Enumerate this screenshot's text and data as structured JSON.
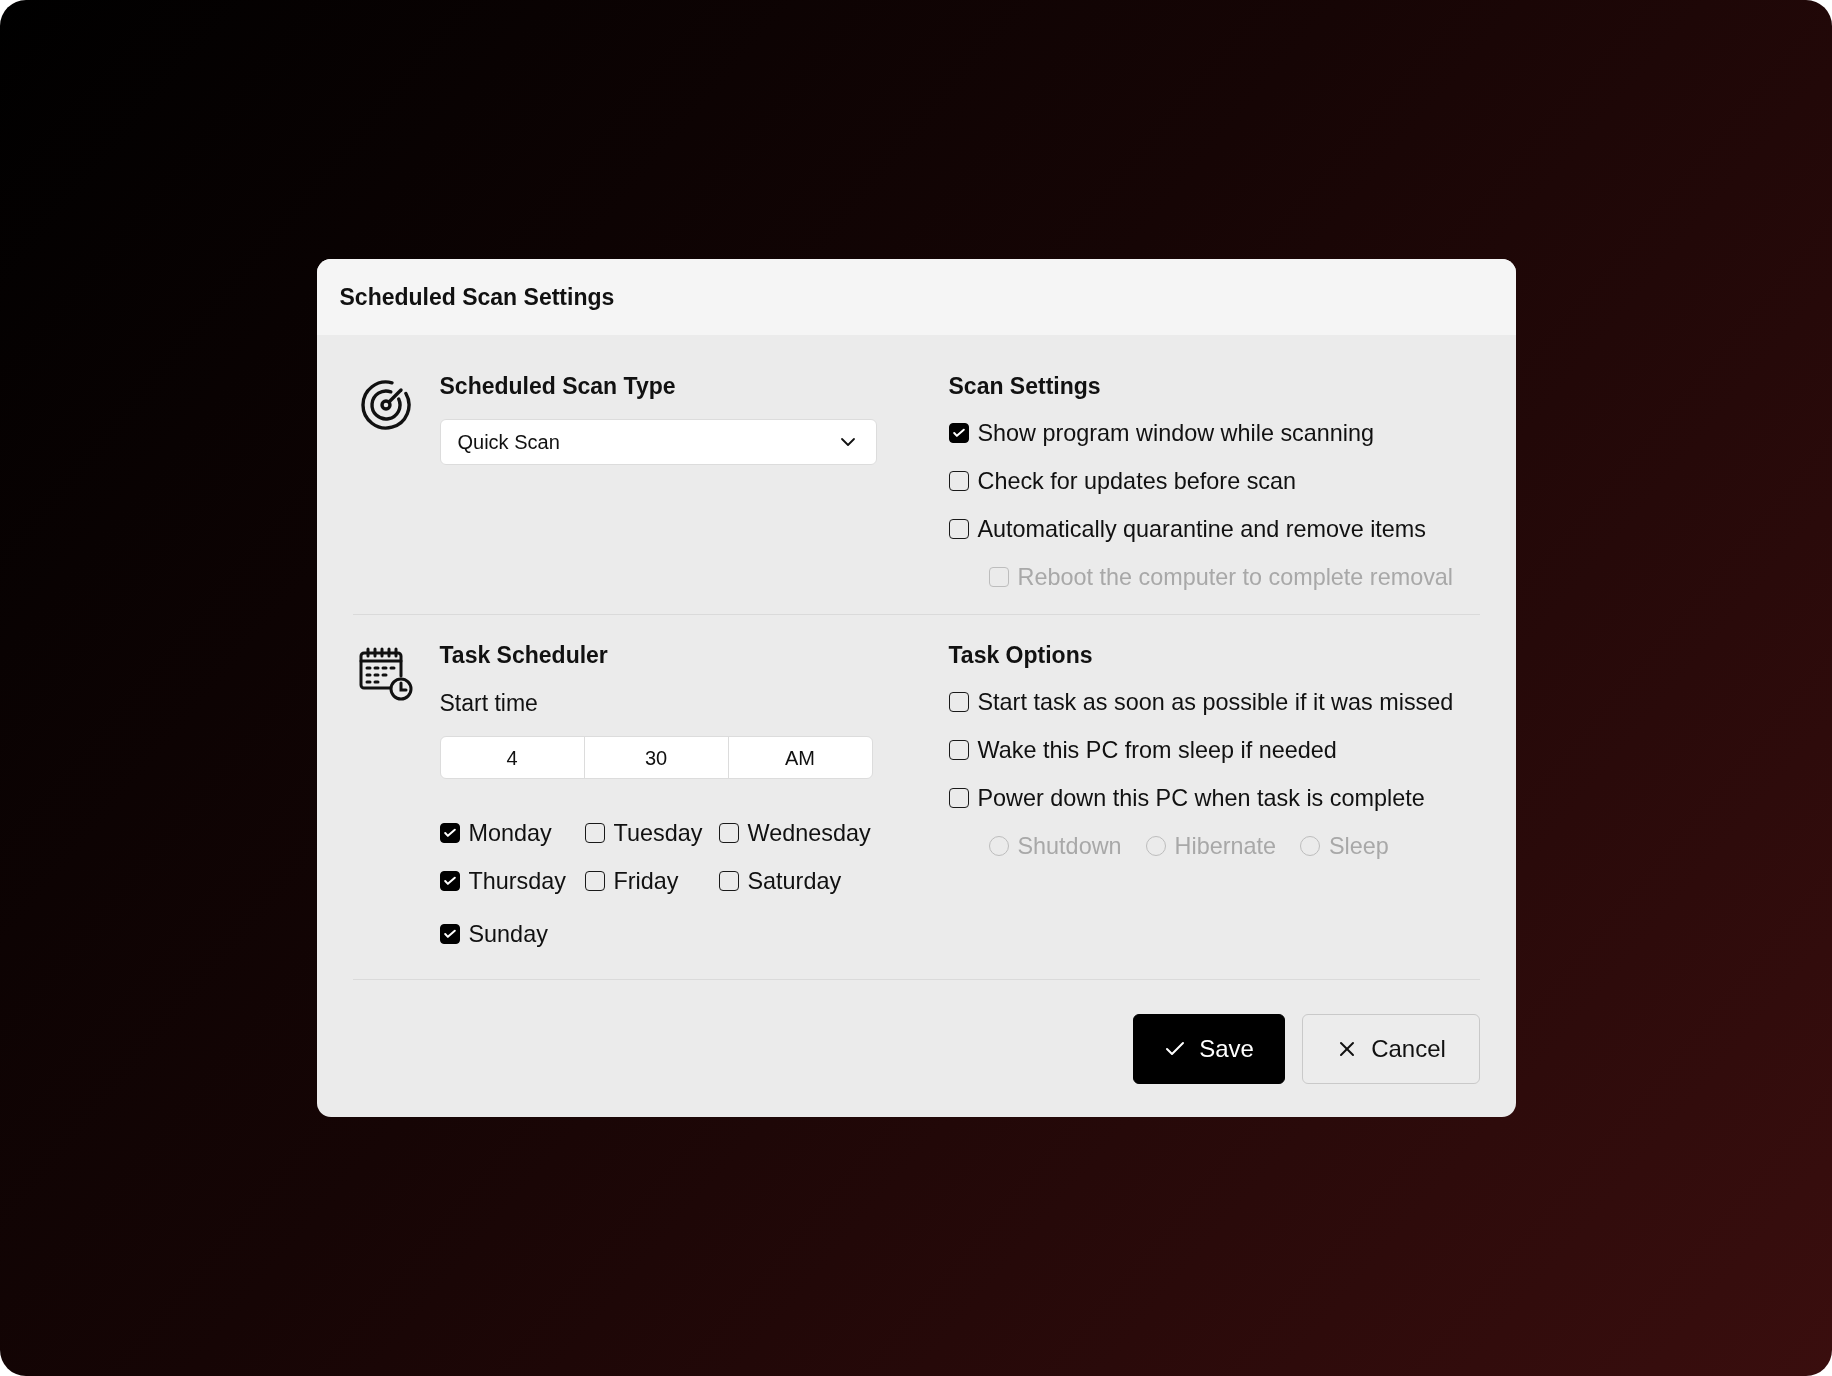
{
  "dialog": {
    "title": "Scheduled Scan Settings"
  },
  "scan_type": {
    "heading": "Scheduled Scan Type",
    "dropdown": {
      "value": "Quick Scan"
    }
  },
  "scan_settings": {
    "heading": "Scan Settings",
    "options": [
      {
        "kind": "checkbox",
        "label": "Show program window while scanning",
        "checked": true,
        "disabled": false
      },
      {
        "kind": "checkbox",
        "label": "Check for updates before scan",
        "checked": false,
        "disabled": false
      },
      {
        "kind": "checkbox",
        "label": "Automatically quarantine and remove items",
        "checked": false,
        "disabled": false,
        "children": [
          {
            "kind": "checkbox",
            "label": "Reboot the computer to complete removal",
            "checked": false,
            "disabled": true
          }
        ]
      }
    ]
  },
  "task_scheduler": {
    "heading": "Task Scheduler",
    "start_time_label": "Start time",
    "start_time": {
      "hour": "4",
      "minute": "30",
      "period": "AM"
    },
    "days": [
      {
        "label": "Monday",
        "checked": true
      },
      {
        "label": "Tuesday",
        "checked": false
      },
      {
        "label": "Wednesday",
        "checked": false
      },
      {
        "label": "Thursday",
        "checked": true
      },
      {
        "label": "Friday",
        "checked": false
      },
      {
        "label": "Saturday",
        "checked": false
      },
      {
        "label": "Sunday",
        "checked": true
      }
    ]
  },
  "task_options": {
    "heading": "Task Options",
    "options": [
      {
        "kind": "checkbox",
        "label": "Start task as soon as possible if it was missed",
        "checked": false,
        "disabled": false
      },
      {
        "kind": "checkbox",
        "label": "Wake this PC from sleep if needed",
        "checked": false,
        "disabled": false
      },
      {
        "kind": "checkbox",
        "label": "Power down this PC when task is complete",
        "checked": false,
        "disabled": false,
        "children": [
          {
            "kind": "radio",
            "label": "Shutdown",
            "selected": false,
            "disabled": true
          },
          {
            "kind": "radio",
            "label": "Hibernate",
            "selected": false,
            "disabled": true
          },
          {
            "kind": "radio",
            "label": "Sleep",
            "selected": false,
            "disabled": true
          }
        ]
      }
    ]
  },
  "buttons": [
    {
      "kind": "primary",
      "label": "Save"
    },
    {
      "kind": "secondary",
      "label": "Cancel"
    }
  ]
}
